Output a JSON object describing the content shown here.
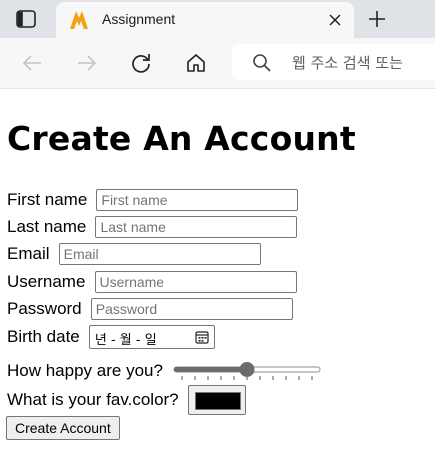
{
  "browser": {
    "tab_title": "Assignment",
    "omnibox_placeholder": "웹 주소 검색 또는"
  },
  "page": {
    "heading": "Create An Account",
    "fields": {
      "first_name": {
        "label": "First name",
        "placeholder": "First name"
      },
      "last_name": {
        "label": "Last name",
        "placeholder": "Last name"
      },
      "email": {
        "label": "Email",
        "placeholder": "Email"
      },
      "username": {
        "label": "Username",
        "placeholder": "Username"
      },
      "password": {
        "label": "Password",
        "placeholder": "Password"
      },
      "birth_date": {
        "label": "Birth date",
        "value_text": "년 - 월 - 일"
      },
      "happiness": {
        "label": "How happy are you?",
        "value": 0.5
      },
      "fav_color": {
        "label": "What is your fav.color?",
        "value": "#000000"
      }
    },
    "submit_label": "Create Account"
  },
  "colors": {
    "accent": "#6b6b6b",
    "favicon": "#f2a20c"
  }
}
